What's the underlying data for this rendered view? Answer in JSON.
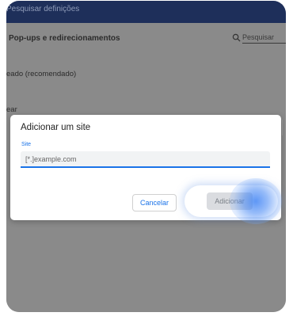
{
  "topbar": {
    "search_settings": "Pesquisar definições"
  },
  "page": {
    "title": "Pop-ups e redirecionamentos",
    "search_placeholder": "Pesquisar",
    "option_blocked": "eado (recomendado)",
    "option_allowed": "ear"
  },
  "dialog": {
    "title": "Adicionar um site",
    "field_label": "Site",
    "field_placeholder": "[*.]example.com",
    "cancel_label": "Cancelar",
    "add_label": "Adicionar"
  },
  "icons": {
    "search": "search-icon"
  },
  "colors": {
    "accent": "#1a73e8",
    "topbar": "#1e2f5a",
    "tap_indicator": "#4285f4"
  }
}
